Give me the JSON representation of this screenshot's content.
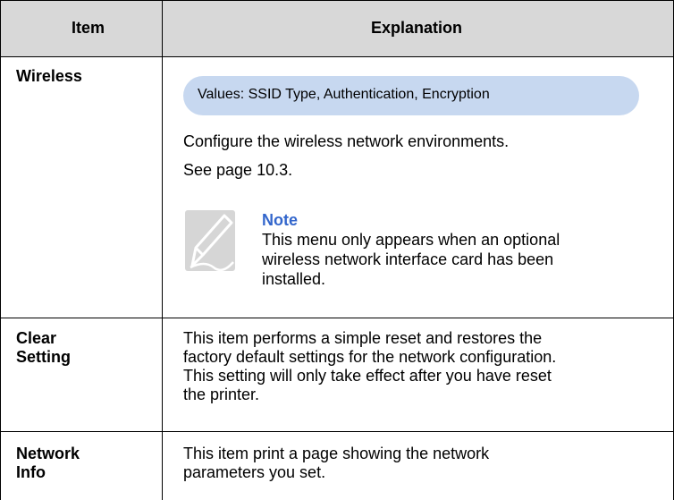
{
  "header": {
    "item": "Item",
    "explanation": "Explanation"
  },
  "rows": [
    {
      "item_lines": [
        "Wireless"
      ],
      "values_pill": "Values: SSID Type, Authentication, Encryption",
      "explanation_lines": [
        "Configure the wireless network environments.",
        "See page 10.3."
      ],
      "note": {
        "title": "Note",
        "lines": [
          "This menu only appears when an optional",
          "wireless network interface card has been",
          "installed."
        ]
      }
    },
    {
      "item_lines": [
        "Clear",
        "Setting"
      ],
      "explanation_lines": [
        "This item performs a simple reset and restores the",
        "factory default settings for the network configuration.",
        "This setting will only take effect after you have reset",
        "the printer."
      ]
    },
    {
      "item_lines": [
        "Network",
        "Info"
      ],
      "explanation_lines": [
        "This item print a page showing the network",
        "parameters you set."
      ]
    }
  ],
  "colors": {
    "header_bg": "#d8d8d8",
    "pill_bg": "#c7d8f0",
    "note_title": "#3366cc"
  },
  "icons": {
    "note": "note-pencil-icon"
  }
}
